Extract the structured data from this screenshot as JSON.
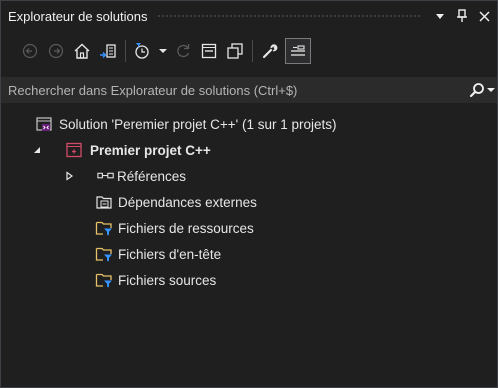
{
  "panel": {
    "title": "Explorateur de solutions"
  },
  "search": {
    "placeholder": "Rechercher dans Explorateur de solutions (Ctrl+$)"
  },
  "tree": {
    "solution": "Solution 'Peremier projet C++' (1 sur 1 projets)",
    "project": "Premier projet C++",
    "items": [
      {
        "label": "Références",
        "icon": "references-icon"
      },
      {
        "label": "Dépendances externes",
        "icon": "external-dependencies-icon"
      },
      {
        "label": "Fichiers de ressources",
        "icon": "filter-folder-icon"
      },
      {
        "label": "Fichiers d'en-tête",
        "icon": "filter-folder-icon"
      },
      {
        "label": "Fichiers sources",
        "icon": "filter-folder-icon"
      }
    ]
  },
  "colors": {
    "background": "#1f1f1f",
    "accent": "#3794ff",
    "folder": "#e8c169",
    "project_icon": "#d14a68"
  }
}
